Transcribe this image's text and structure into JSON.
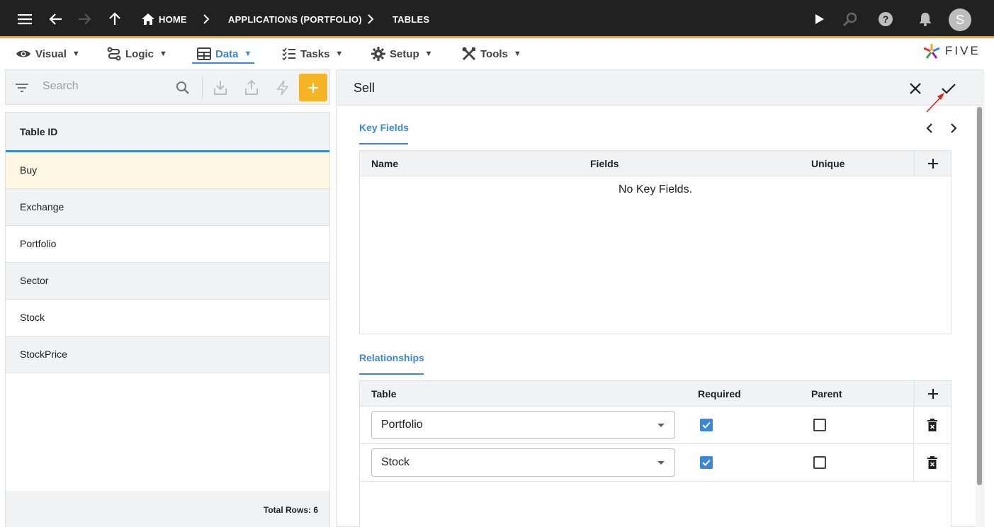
{
  "breadcrumb": {
    "home": "HOME",
    "applications": "APPLICATIONS (PORTFOLIO)",
    "tables": "TABLES"
  },
  "user": {
    "avatar_initial": "S"
  },
  "menu": {
    "items": [
      {
        "label": "Visual",
        "icon": "eye-icon"
      },
      {
        "label": "Logic",
        "icon": "flow-icon"
      },
      {
        "label": "Data",
        "icon": "table-icon",
        "active": true
      },
      {
        "label": "Tasks",
        "icon": "checklist-icon"
      },
      {
        "label": "Setup",
        "icon": "gear-icon"
      },
      {
        "label": "Tools",
        "icon": "tools-icon"
      }
    ],
    "arrow": "▼"
  },
  "logo": {
    "text": "FIVE"
  },
  "search": {
    "placeholder": "Search"
  },
  "list": {
    "header": "Table ID",
    "rows": [
      "Buy",
      "Exchange",
      "Portfolio",
      "Sector",
      "Stock",
      "StockPrice"
    ],
    "selected_index": 0,
    "footer": "Total Rows: 6"
  },
  "form": {
    "title": "Sell",
    "key_fields": {
      "tab_label": "Key Fields",
      "columns": [
        "Name",
        "Fields",
        "Unique"
      ],
      "empty_text": "No Key Fields."
    },
    "relationships": {
      "tab_label": "Relationships",
      "columns": [
        "Table",
        "Required",
        "Parent"
      ],
      "rows": [
        {
          "table": "Portfolio",
          "required": true,
          "parent": false
        },
        {
          "table": "Stock",
          "required": true,
          "parent": false
        }
      ]
    }
  },
  "colors": {
    "accent": "#3c87d6",
    "topbar": "#212121",
    "topbar_border": "#f5a623",
    "add_button": "#f6b324",
    "selected_row": "#fff6e3",
    "annotation_arrow": "#e02020"
  }
}
